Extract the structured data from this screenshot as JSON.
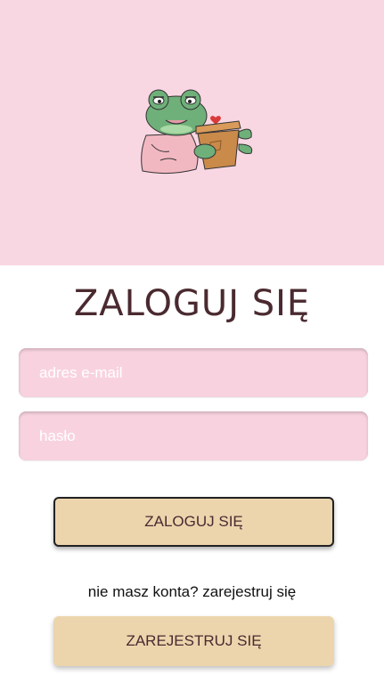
{
  "hero": {
    "illustration": "frog-with-plant-icon",
    "background": "#f8d7e3"
  },
  "title": "ZALOGUJ SIĘ",
  "form": {
    "email_placeholder": "adres e-mail",
    "password_placeholder": "hasło",
    "login_button": "ZALOGUJ SIĘ"
  },
  "register": {
    "prompt": "nie masz konta? zarejestruj się",
    "button": "ZAREJESTRUJ SIĘ"
  },
  "colors": {
    "accent": "#ecd5ad",
    "field": "#f8d3df",
    "title": "#4a2a30"
  }
}
